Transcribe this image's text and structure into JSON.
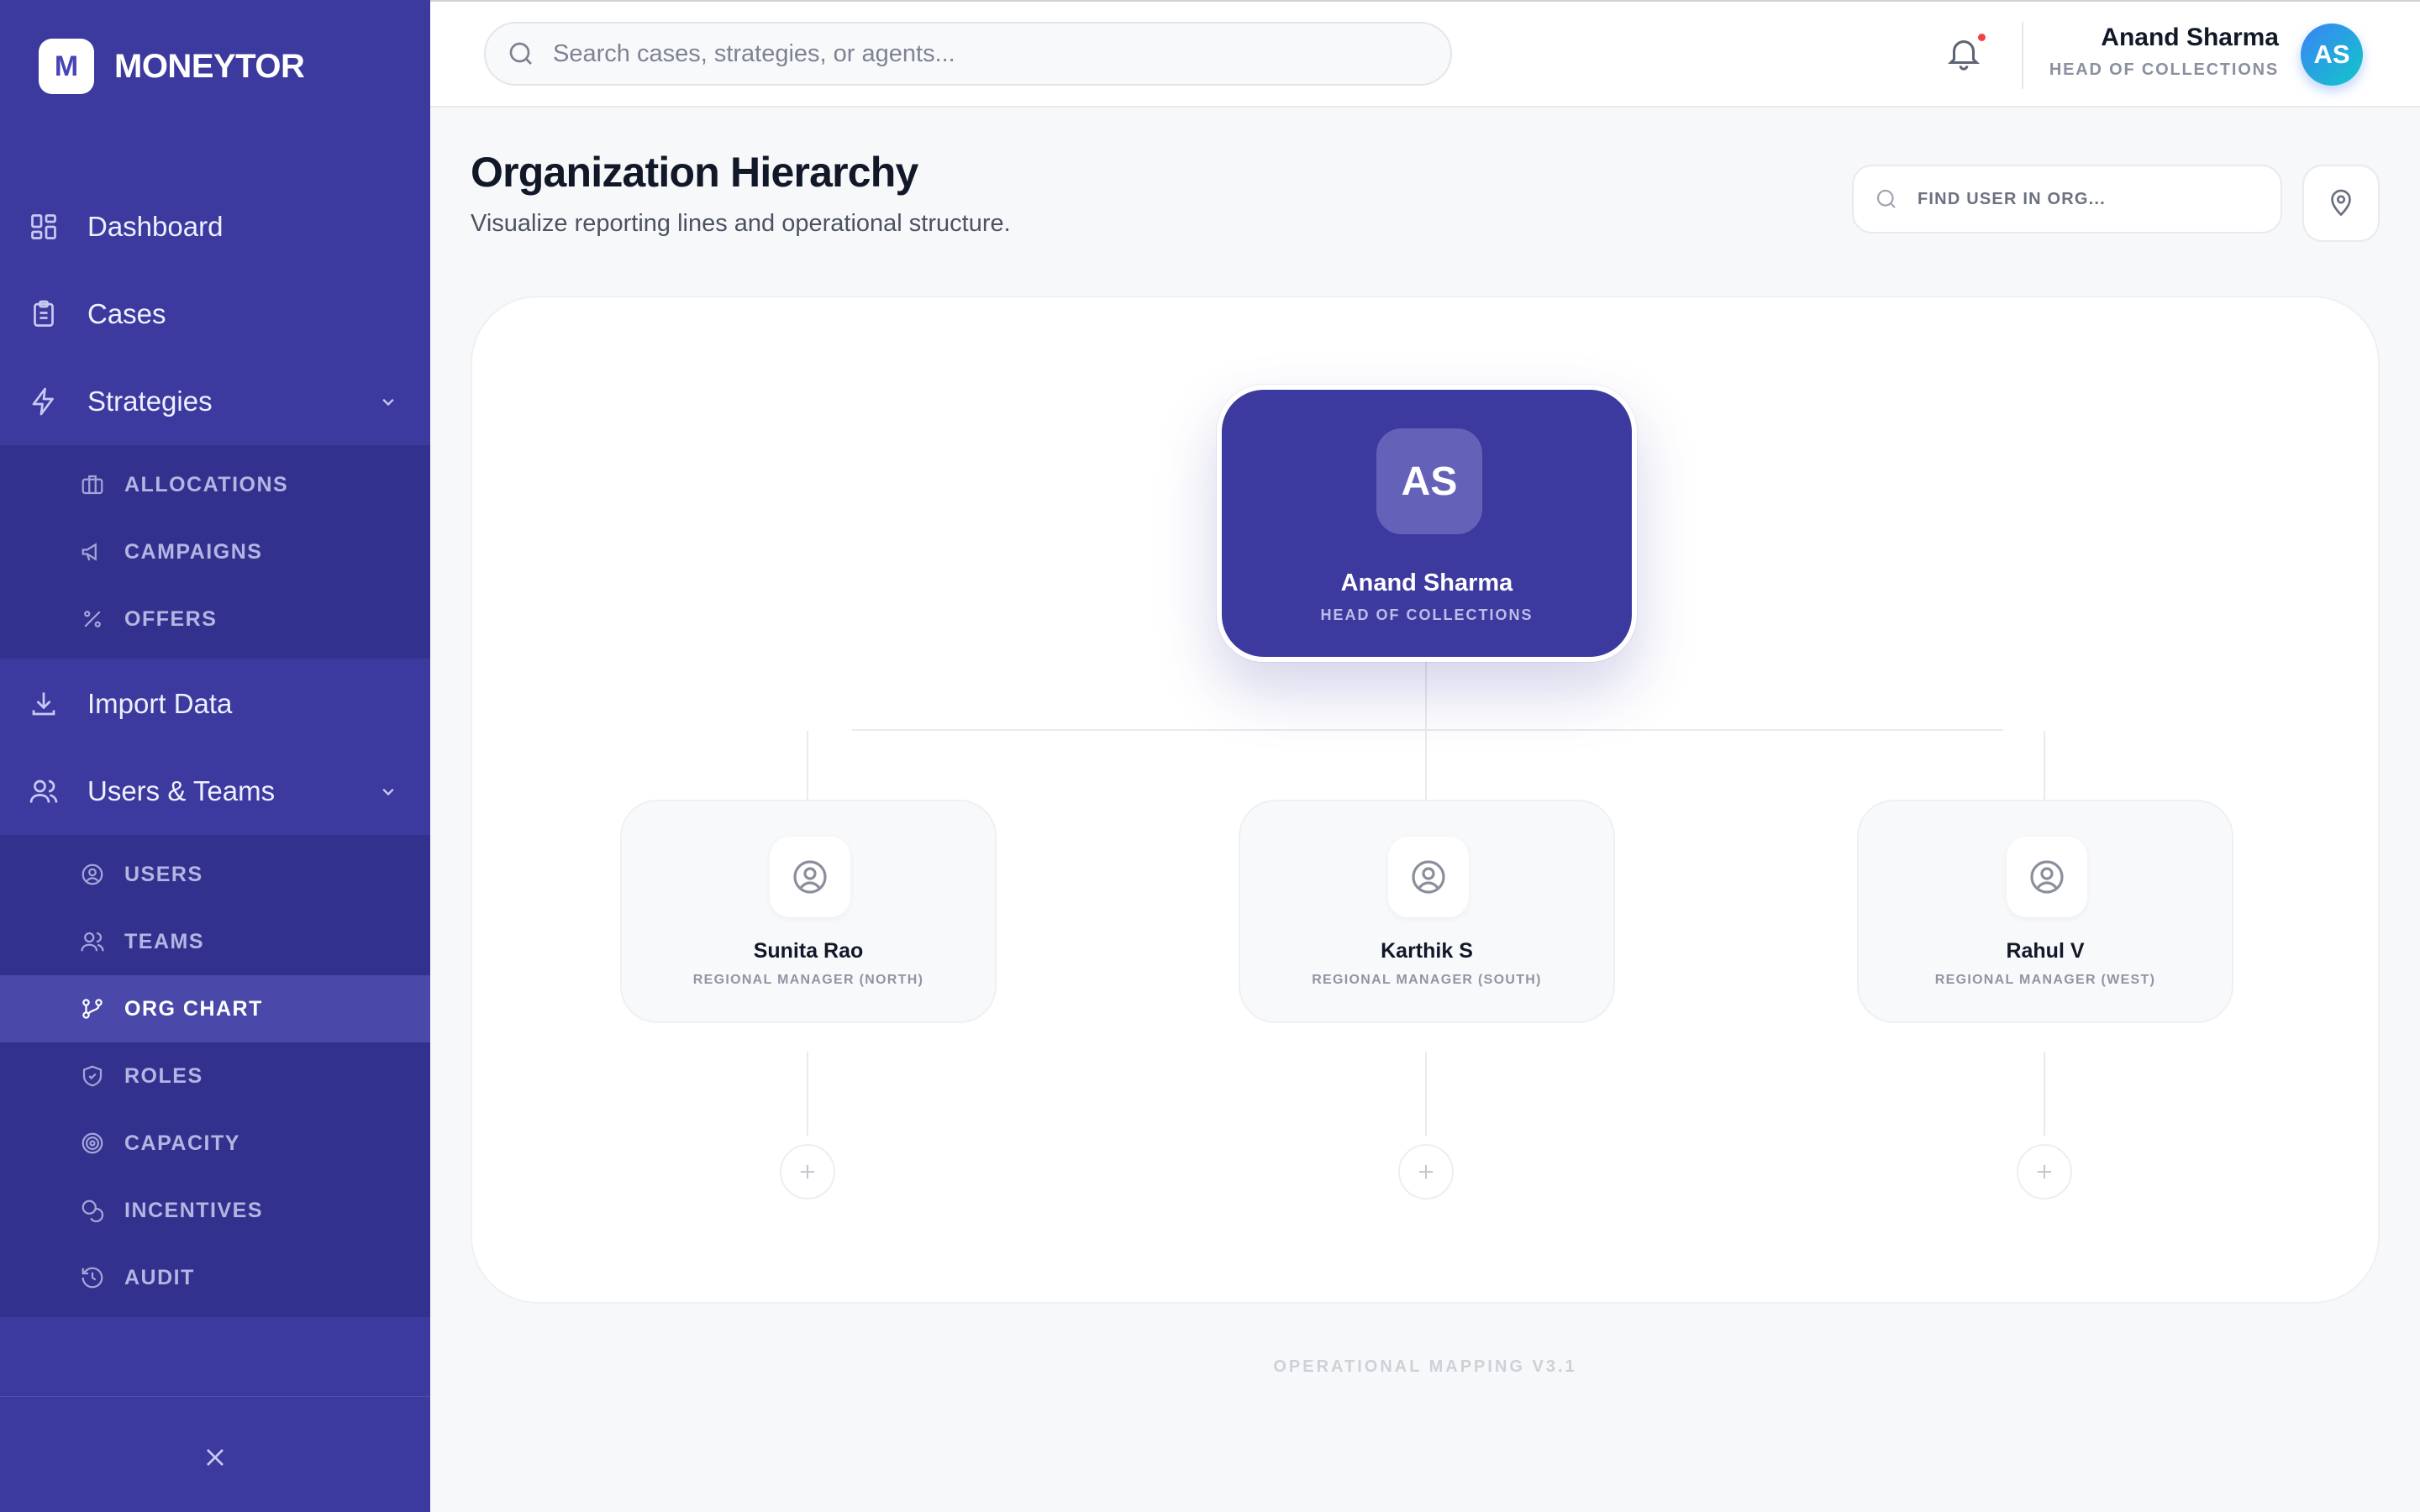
{
  "brand": {
    "logo_letter": "M",
    "name": "MONEYTOR"
  },
  "sidebar": {
    "items": [
      {
        "label": "Dashboard",
        "icon": "grid-icon"
      },
      {
        "label": "Cases",
        "icon": "clipboard-icon"
      },
      {
        "label": "Strategies",
        "icon": "lightning-icon",
        "expanded": true
      },
      {
        "label": "Import Data",
        "icon": "download-icon"
      },
      {
        "label": "Users & Teams",
        "icon": "users-icon",
        "expanded": true
      }
    ],
    "strategies_sub": [
      {
        "label": "ALLOCATIONS",
        "icon": "briefcase-icon"
      },
      {
        "label": "CAMPAIGNS",
        "icon": "megaphone-icon"
      },
      {
        "label": "OFFERS",
        "icon": "percent-icon"
      }
    ],
    "users_sub": [
      {
        "label": "USERS",
        "icon": "user-circle-icon"
      },
      {
        "label": "TEAMS",
        "icon": "team-icon"
      },
      {
        "label": "ORG CHART",
        "icon": "org-chart-icon",
        "active": true
      },
      {
        "label": "ROLES",
        "icon": "shield-icon"
      },
      {
        "label": "CAPACITY",
        "icon": "target-icon"
      },
      {
        "label": "INCENTIVES",
        "icon": "coins-icon"
      },
      {
        "label": "AUDIT",
        "icon": "history-icon"
      }
    ]
  },
  "header": {
    "search_placeholder": "Search cases, strategies, or agents...",
    "user": {
      "name": "Anand Sharma",
      "role": "HEAD OF COLLECTIONS",
      "initials": "AS"
    },
    "notification_dot": true
  },
  "page": {
    "title": "Organization Hierarchy",
    "subtitle": "Visualize reporting lines and operational structure.",
    "find_user_placeholder": "FIND USER IN ORG..."
  },
  "org": {
    "root": {
      "initials": "AS",
      "name": "Anand Sharma",
      "role": "HEAD OF COLLECTIONS"
    },
    "children": [
      {
        "name": "Sunita Rao",
        "role": "REGIONAL MANAGER (NORTH)"
      },
      {
        "name": "Karthik S",
        "role": "REGIONAL MANAGER (SOUTH)"
      },
      {
        "name": "Rahul V",
        "role": "REGIONAL MANAGER (WEST)"
      }
    ]
  },
  "footer": {
    "text": "OPERATIONAL MAPPING V3.1"
  },
  "colors": {
    "sidebar": "#3c3a9e",
    "sidebar_sub": "#33318e",
    "active": "#4a48a8",
    "accent": "#3b82f6",
    "alert": "#ef4444"
  }
}
